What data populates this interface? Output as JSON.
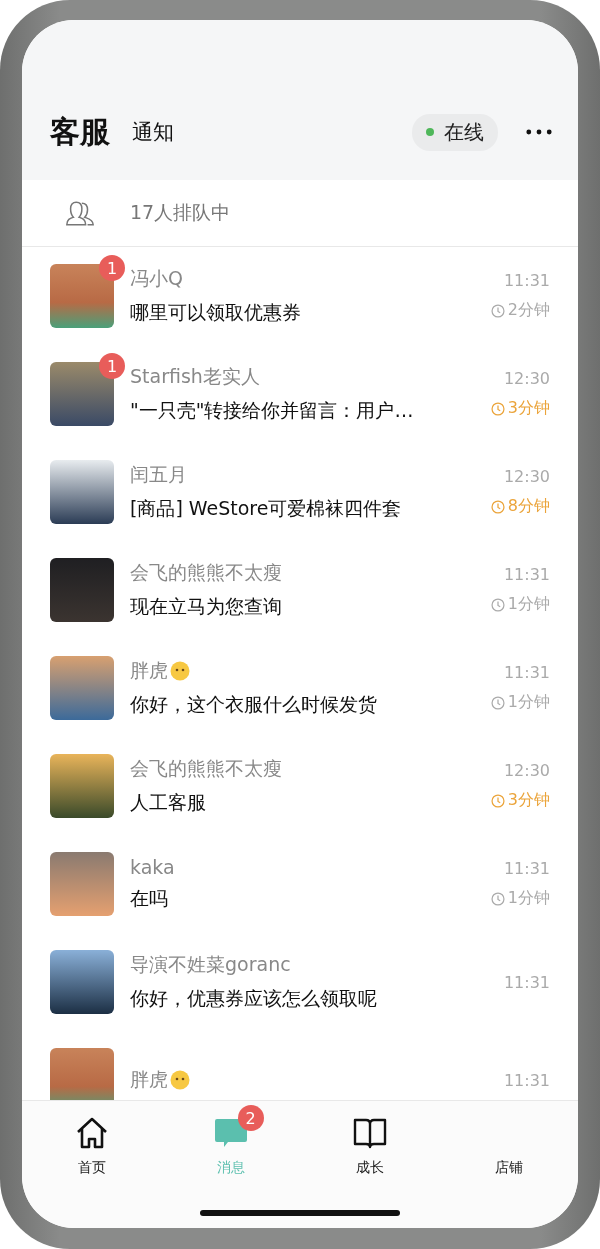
{
  "header": {
    "title": "客服",
    "tabs": [
      {
        "label": "通知",
        "selected": false
      }
    ],
    "status": {
      "label": "在线",
      "online": true
    }
  },
  "queue": {
    "text": "17人排队中"
  },
  "conversations": [
    {
      "name": "冯小Q",
      "name_emoji": false,
      "badge": "1",
      "time": "11:31",
      "message": "哪里可以领取优惠券",
      "wait": "2分钟",
      "overdue": false
    },
    {
      "name": "Starfish老实人",
      "name_emoji": false,
      "badge": "1",
      "time": "12:30",
      "message": "\"一只壳\"转接给你并留言：用户…",
      "wait": "3分钟",
      "overdue": true
    },
    {
      "name": "闰五月",
      "name_emoji": false,
      "time": "12:30",
      "message": "[商品] WeStore可爱棉袜四件套",
      "wait": "8分钟",
      "overdue": true
    },
    {
      "name": "会飞的熊熊不太瘦",
      "name_emoji": false,
      "time": "11:31",
      "message": "现在立马为您查询",
      "wait": "1分钟",
      "overdue": false
    },
    {
      "name": "胖虎",
      "name_emoji": true,
      "time": "11:31",
      "message": "你好，这个衣服什么时候发货",
      "wait": "1分钟",
      "overdue": false
    },
    {
      "name": "会飞的熊熊不太瘦",
      "name_emoji": false,
      "time": "12:30",
      "message": "人工客服",
      "wait": "3分钟",
      "overdue": true
    },
    {
      "name": "kaka",
      "name_emoji": false,
      "time": "11:31",
      "message": "在吗",
      "wait": "1分钟",
      "overdue": false
    },
    {
      "name": "导演不姓菜goranc",
      "name_emoji": false,
      "time": "11:31",
      "message": "你好，优惠券应该怎么领取呢"
    },
    {
      "name": "胖虎",
      "name_emoji": true,
      "time": "11:31"
    }
  ],
  "tab_bar": [
    {
      "label": "首页",
      "kind": "home",
      "selected": false
    },
    {
      "label": "消息",
      "kind": "chat",
      "selected": true,
      "badge": "2"
    },
    {
      "label": "成长",
      "kind": "book",
      "selected": false
    },
    {
      "label": "店铺",
      "selected": false
    }
  ]
}
